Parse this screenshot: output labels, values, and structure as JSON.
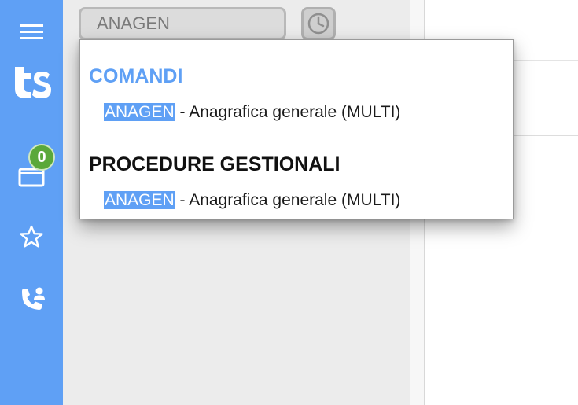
{
  "sidebar": {
    "menu_icon": "hamburger-menu-icon",
    "logo_icon": "ts-logo",
    "inbox_icon": "inbox-icon",
    "inbox_badge": "0",
    "favorites_icon": "star-icon",
    "contact_icon": "phone-contact-icon",
    "color": "#5fa0f5",
    "badge_color": "#5aa83a"
  },
  "search": {
    "value": "ANAGEN",
    "history_icon": "clock-icon"
  },
  "dropdown": {
    "sections": [
      {
        "title": "COMANDI",
        "title_color": "#5fa0f5",
        "items": [
          {
            "highlight": "ANAGEN",
            "rest": " - Anagrafica generale (MULTI)"
          }
        ]
      },
      {
        "title": "PROCEDURE GESTIONALI",
        "title_color": "#111111",
        "items": [
          {
            "highlight": "ANAGEN",
            "rest": " - Anagrafica generale (MULTI)"
          }
        ]
      }
    ],
    "highlight_color": "#5fa0f5"
  }
}
